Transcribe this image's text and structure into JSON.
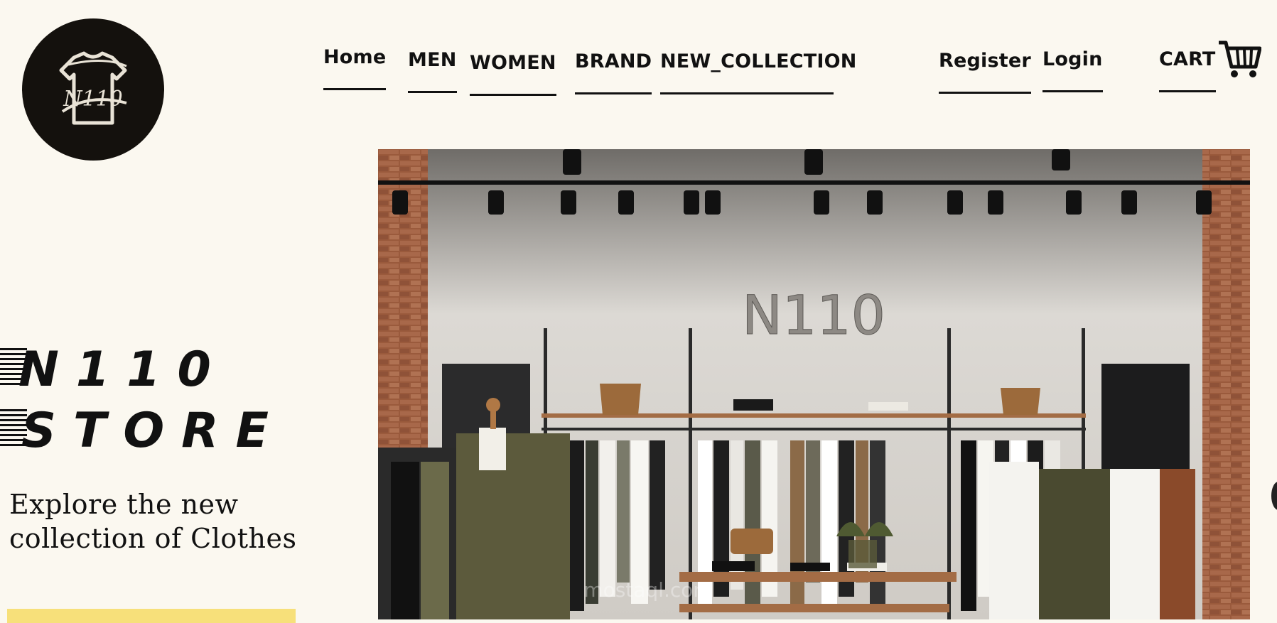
{
  "nav": {
    "home": "Home",
    "men": "MEN",
    "women": "WOMEN",
    "brand": "BRAND",
    "new_collection": "NEW_COLLECTION",
    "register": "Register",
    "login": "Login",
    "cart": "CART"
  },
  "logo": {
    "text": "N110"
  },
  "hero": {
    "store_sign": "N110",
    "watermark": "mostaql.com"
  },
  "store_title": {
    "line1": "N110",
    "line2": "STORE"
  },
  "tagline": "Explore the new collection of Clothes",
  "colors": {
    "background": "#fbf8f0",
    "logo_bg": "#14110d",
    "cta": "#f7e07a",
    "brick": "#9a5a3c"
  },
  "icons": {
    "cart": "cart-icon",
    "logo": "tshirt-icon"
  }
}
